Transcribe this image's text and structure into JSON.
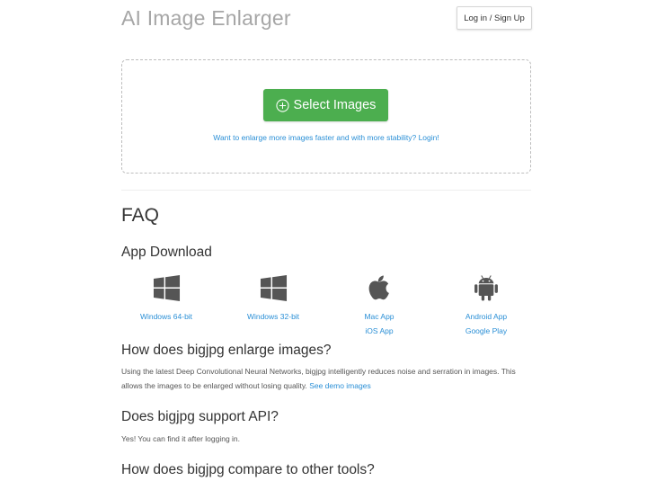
{
  "header": {
    "app_title": "AI Image Enlarger",
    "login_label": "Log in / Sign Up"
  },
  "upload": {
    "select_label": "Select Images",
    "login_hint": "Want to enlarge more images faster and with more stability? Login!"
  },
  "faq": {
    "title": "FAQ",
    "app_download": {
      "title": "App Download",
      "items": [
        {
          "icon": "windows-icon",
          "links": [
            "Windows 64-bit"
          ]
        },
        {
          "icon": "windows-icon",
          "links": [
            "Windows 32-bit"
          ]
        },
        {
          "icon": "apple-icon",
          "links": [
            "Mac App",
            "iOS App"
          ]
        },
        {
          "icon": "android-icon",
          "links": [
            "Android App",
            "Google Play"
          ]
        }
      ]
    },
    "q1": {
      "title": "How does bigjpg enlarge images?",
      "text": "Using the latest Deep Convolutional Neural Networks, bigjpg intelligently reduces noise and serration in images. This allows the images to be enlarged without losing quality.",
      "link": "See demo images"
    },
    "q2": {
      "title": "Does bigjpg support API?",
      "text": "Yes! You can find it after logging in."
    },
    "q3": {
      "title": "How does bigjpg compare to other tools?"
    }
  },
  "colors": {
    "accent_green": "#4cae4f",
    "link_blue": "#2a8fd6",
    "title_gray": "#a6a6a6",
    "icon_gray": "#555555"
  }
}
